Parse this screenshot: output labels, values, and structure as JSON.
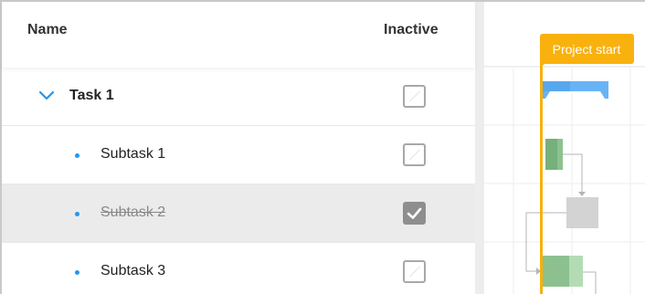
{
  "grid": {
    "columns": {
      "name": "Name",
      "inactive": "Inactive"
    },
    "rows": [
      {
        "label": "Task 1",
        "level": 0,
        "expanded": true,
        "inactive": false
      },
      {
        "label": "Subtask 1",
        "level": 1,
        "inactive": false
      },
      {
        "label": "Subtask 2",
        "level": 1,
        "inactive": true,
        "selected": true
      },
      {
        "label": "Subtask 3",
        "level": 1,
        "inactive": false
      }
    ]
  },
  "timeline": {
    "marker_label": "Project start",
    "marker_color": "#f9b10d",
    "colors": {
      "summary": "#68b3f6",
      "task": "#8cc18f",
      "inactive": "#d3d3d3",
      "connector": "#b5b5b5",
      "accent": "#2196f3"
    }
  }
}
